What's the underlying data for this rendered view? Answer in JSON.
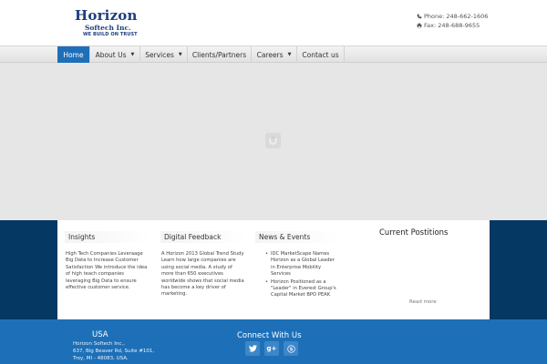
{
  "logo": {
    "name": "Horizon",
    "sub": "Softech Inc.",
    "tagline": "WE BUILD ON TRUST"
  },
  "contact": {
    "phone": "Phone: 248-662-1606",
    "fax": "Fax: 248-688-9655"
  },
  "nav": {
    "items": [
      {
        "label": "Home",
        "active": true
      },
      {
        "label": "About Us",
        "dropdown": true
      },
      {
        "label": "Services",
        "dropdown": true
      },
      {
        "label": "Clients/Partners"
      },
      {
        "label": "Careers",
        "dropdown": true
      },
      {
        "label": "Contact us"
      }
    ]
  },
  "sections": {
    "insights": {
      "title": "Insights",
      "lines": [
        "High Tech Companies Leveraage",
        "Big Data to Increase Customer",
        "Satisfaction We introduce the idea",
        "of high teach companies",
        "leveraging Big Data to ensure",
        "effective customer service."
      ]
    },
    "digital": {
      "title": "Digital Feedback",
      "lines": [
        "A Horizon 2013 Global Trend Study",
        "Learn how large companies are",
        "using social media. A study of",
        "more than 650 executives",
        "worldwide shows that social media",
        "has become a key driver of",
        "marketing."
      ]
    },
    "news": {
      "title": "News & Events",
      "items": [
        {
          "lines": [
            "IDC MarketScape Names",
            "Horizon as a Global Leader",
            "in Enterprise Mobility",
            "Services"
          ]
        },
        {
          "lines": [
            "Horizon Positioned as a",
            "\"Leader\" in Everest Group's",
            "Capital Market BPO PEAK"
          ]
        }
      ]
    },
    "current_positions": "Current Postitions",
    "read_more": "Read more"
  },
  "footer": {
    "usa_title": "USA",
    "address": [
      "Horizon Softech Inc.,",
      "637, Big Beaver Rd, Suite #101,",
      "Troy, MI - 48083, USA."
    ],
    "connect_title": "Connect With Us",
    "social": [
      {
        "icon": "twitter-icon"
      },
      {
        "icon": "google-plus-icon",
        "text": "g+"
      },
      {
        "icon": "skype-icon"
      }
    ]
  },
  "colors": {
    "brand_blue": "#1d3f7e",
    "nav_active": "#1f6fb8",
    "band_dark": "#053862",
    "footer_blue": "#1d70b8"
  }
}
